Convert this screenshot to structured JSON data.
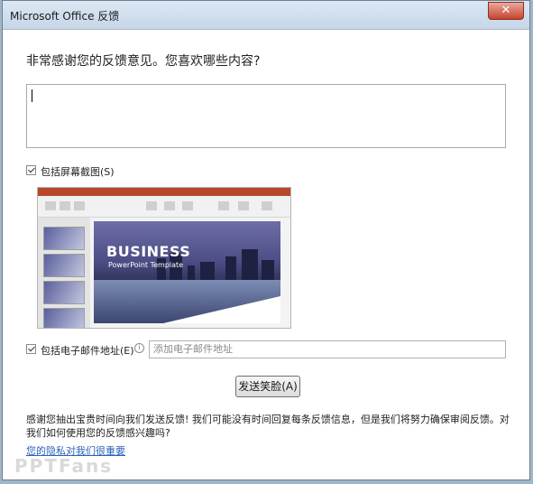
{
  "window": {
    "title": "Microsoft Office 反馈",
    "close_glyph": "✕"
  },
  "question": "非常感谢您的反馈意见。您喜欢哪些内容?",
  "feedback_input": {
    "value": ""
  },
  "screenshot_option": {
    "label": "包括屏幕截图(S)",
    "checked": true
  },
  "screenshot_preview": {
    "slide_title": "BUSINESS",
    "slide_subtitle": "PowerPoint Template"
  },
  "email_option": {
    "label": "包括电子邮件地址(E)",
    "checked": true,
    "info_glyph": "i",
    "placeholder": "添加电子邮件地址"
  },
  "send_button": "发送笑脸(A)",
  "note": "感谢您抽出宝贵时间向我们发送反馈! 我们可能没有时间回复每条反馈信息，但是我们将努力确保审阅反馈。对我们如何使用您的反馈感兴趣吗?",
  "privacy_link": "您的隐私对我们很重要",
  "watermark": "PPTFans",
  "colors": {
    "accent": "#2a63b8",
    "ppt_brand": "#b7472a",
    "close_red": "#c6452f"
  }
}
